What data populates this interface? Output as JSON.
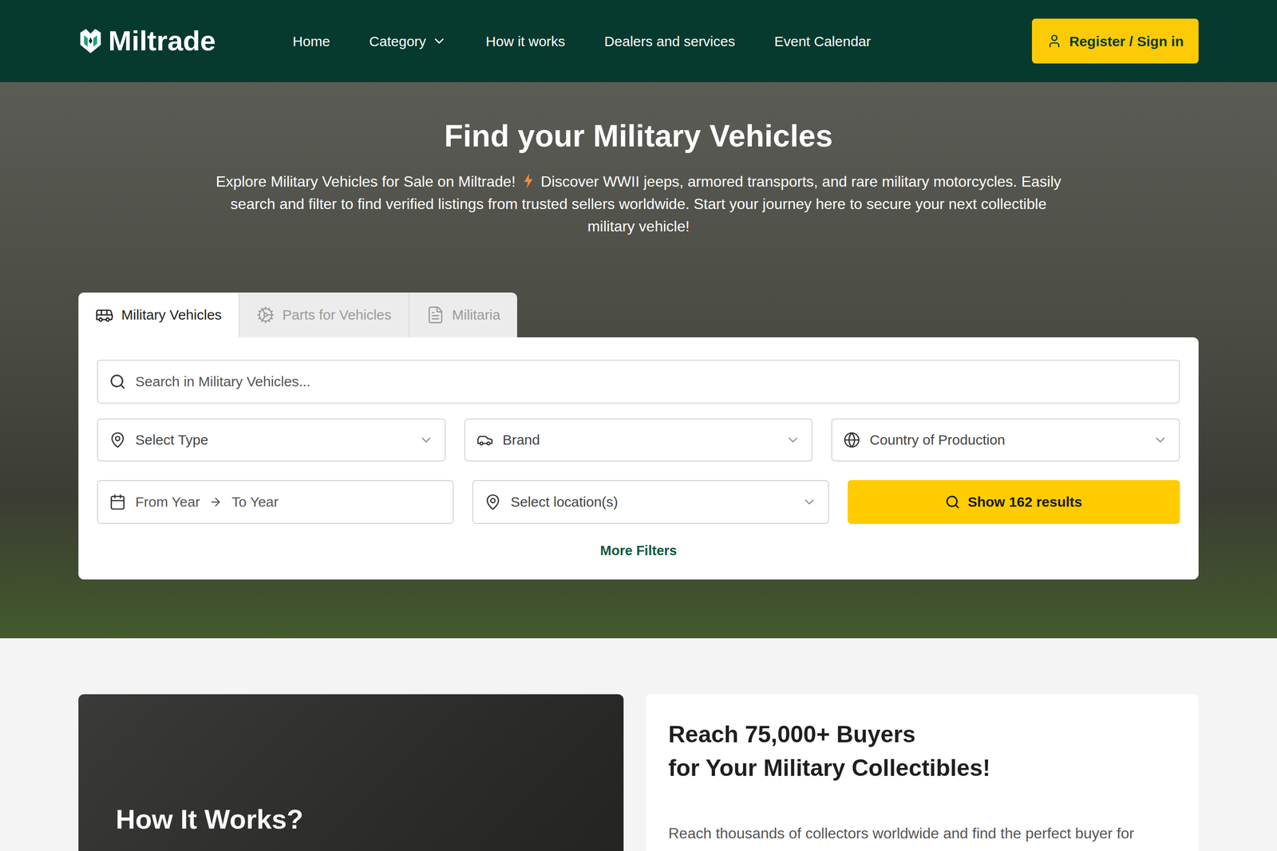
{
  "header": {
    "logo": "Miltrade",
    "nav": [
      {
        "label": "Home",
        "dropdown": false
      },
      {
        "label": "Category",
        "dropdown": true
      },
      {
        "label": "How it works",
        "dropdown": false
      },
      {
        "label": "Dealers and services",
        "dropdown": false
      },
      {
        "label": "Event Calendar",
        "dropdown": false
      }
    ],
    "auth_button": "Register / Sign in"
  },
  "hero": {
    "title": "Find your Military Vehicles",
    "description_start": "Explore Military Vehicles for Sale on Miltrade!",
    "description_end": "Discover WWII jeeps, armored transports, and rare military motorcycles. Easily search and filter to find verified listings from trusted sellers worldwide. Start your journey here to secure your next collectible military vehicle!"
  },
  "tabs": [
    {
      "label": "Military Vehicles",
      "selected": true,
      "kind": "vehicle"
    },
    {
      "label": "Parts for Vehicles",
      "selected": false,
      "kind": "parts"
    },
    {
      "label": "Militaria",
      "selected": false,
      "kind": "militaria"
    }
  ],
  "search": {
    "placeholder": "Search in Military Vehicles..."
  },
  "filters": {
    "type": "Select Type",
    "brand": "Brand",
    "country": "Country of Production",
    "from_year": "From Year",
    "to_year": "To Year",
    "location": "Select location(s)",
    "show_button": "Show 162 results",
    "more_filters": "More Filters"
  },
  "how_it_works": {
    "title": "How It Works?"
  },
  "promo": {
    "heading_line1": "Reach 75,000+ Buyers",
    "heading_line2": "for Your Military Collectibles!",
    "text": "Reach thousands of collectors worldwide and find the perfect buyer for"
  }
}
